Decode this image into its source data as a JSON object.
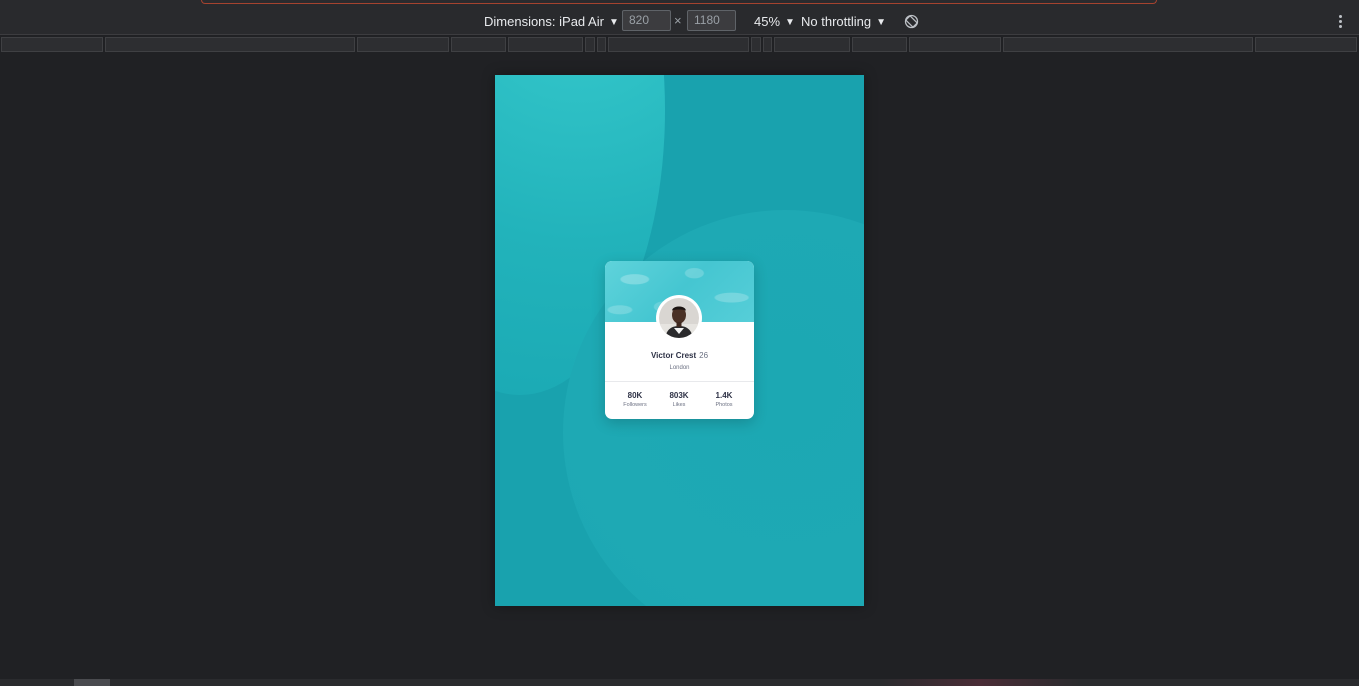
{
  "toolbar": {
    "dimensions_label": "Dimensions: iPad Air",
    "width_value": "820",
    "height_value": "1180",
    "times_symbol": "×",
    "zoom_label": "45%",
    "throttling_label": "No throttling",
    "caret": "▼"
  },
  "icons": {
    "rotate": "rotate-icon",
    "more": "kebab-menu-icon"
  },
  "colors": {
    "page_background": "#19a2ae",
    "card_banner": "#45c6d1",
    "devtools_background": "#202124"
  },
  "profile_card": {
    "name": "Victor Crest",
    "age": "26",
    "city": "London",
    "stats": [
      {
        "value": "80K",
        "label": "Followers"
      },
      {
        "value": "803K",
        "label": "Likes"
      },
      {
        "value": "1.4K",
        "label": "Photos"
      }
    ]
  }
}
